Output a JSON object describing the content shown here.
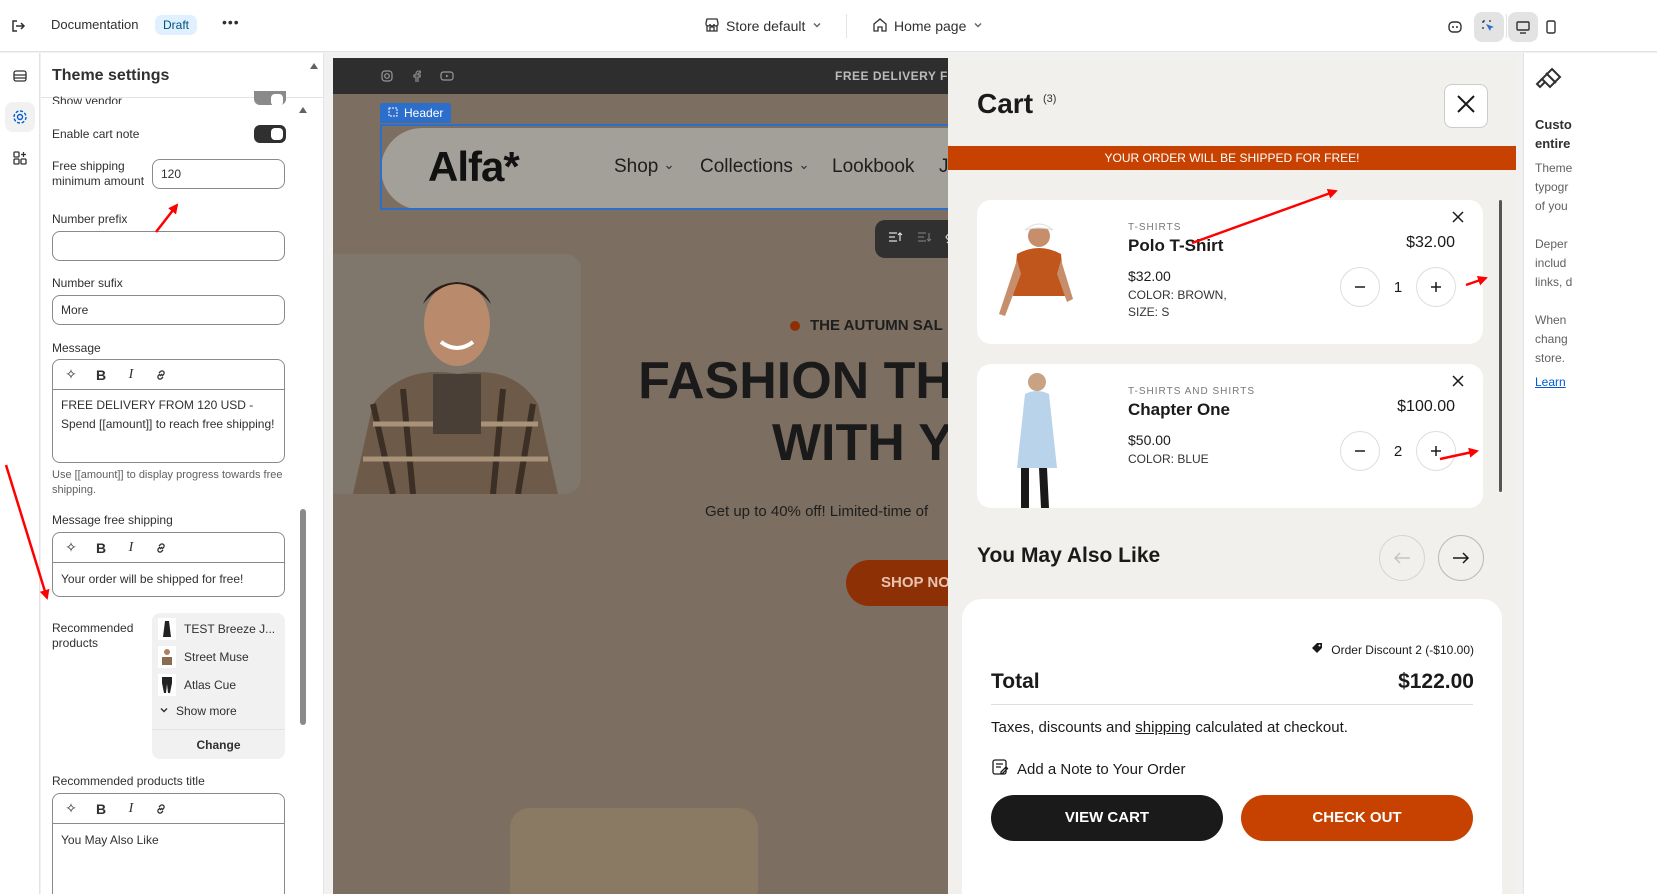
{
  "topbar": {
    "title": "Documentation",
    "badge": "Draft",
    "more": "•••",
    "store_select": "Store default",
    "page_select": "Home page"
  },
  "panel": {
    "title": "Theme settings",
    "show_vendor": "Show vendor",
    "enable_cart_note": "Enable cart note",
    "free_shipping_label": "Free shipping minimum amount",
    "free_shipping_value": "120",
    "number_prefix_label": "Number prefix",
    "number_prefix_value": "",
    "number_sufix_label": "Number sufix",
    "number_sufix_value": "More",
    "message_label": "Message",
    "message_value": "FREE DELIVERY FROM 120 USD - Spend [[amount]] to reach free shipping!",
    "message_hint": "Use [[amount]] to display progress towards free shipping.",
    "message_free_label": "Message free shipping",
    "message_free_value": "Your order will be shipped for free!",
    "recommended_label": "Recommended products",
    "recommended_items": [
      "TEST Breeze J...",
      "Street Muse",
      "Atlas Cue"
    ],
    "show_more": "Show more",
    "change": "Change",
    "rec_title_label": "Recommended products title",
    "rec_title_value": "You May Also Like"
  },
  "preview": {
    "announcement": "FREE DELIVERY FRO",
    "header_tag": "Header",
    "logo": "Alfa*",
    "nav": [
      "Shop",
      "Collections",
      "Lookbook",
      "J"
    ],
    "hero_tag": "THE AUTUMN SAL",
    "hero_title_1": "FASHION TH",
    "hero_title_2": "WITH Y",
    "hero_sub": "Get up to 40% off! Limited-time of",
    "hero_btn": "SHOP NO"
  },
  "cart": {
    "title": "Cart",
    "count": "(3)",
    "free_bar": "YOUR ORDER WILL BE SHIPPED FOR FREE!",
    "items": [
      {
        "category": "T-SHIRTS",
        "name": "Polo T-Shirt",
        "price": "$32.00",
        "meta1": "COLOR: BROWN,",
        "meta2": "SIZE: S",
        "qty": "1",
        "total": "$32.00"
      },
      {
        "category": "T-SHIRTS AND SHIRTS",
        "name": "Chapter One",
        "price": "$50.00",
        "meta1": "COLOR: BLUE",
        "meta2": "",
        "qty": "2",
        "total": "$100.00"
      }
    ],
    "you_may_also_like": "You May Also Like",
    "discount": "Order Discount 2 (-$10.00)",
    "total_label": "Total",
    "total_value": "$122.00",
    "taxes_pre": "Taxes, discounts and ",
    "taxes_link": "shipping",
    "taxes_post": " calculated at checkout.",
    "note": "Add a Note to Your Order",
    "view_cart": "VIEW CART",
    "checkout": "CHECK OUT"
  },
  "rside": {
    "title_1": "Custo",
    "title_2": "entire",
    "lines": [
      "Theme",
      "typogr",
      "of you",
      "",
      "Deper",
      "includ",
      "links, d",
      "",
      "When",
      "chang",
      "store."
    ],
    "link": "Learn"
  },
  "colors": {
    "accent": "#c74200",
    "selection": "#2c6ecb",
    "annotation": "#ff0000"
  }
}
